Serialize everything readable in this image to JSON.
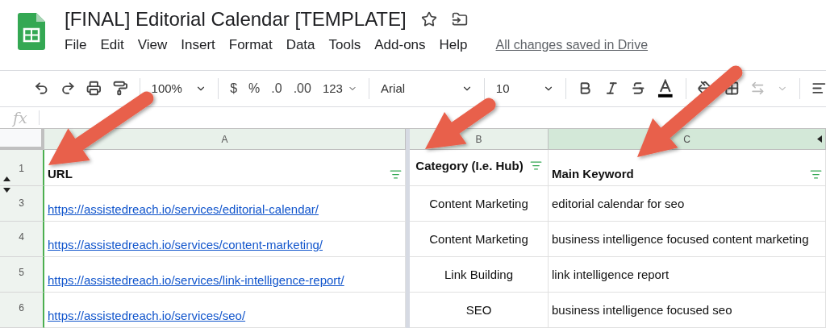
{
  "document": {
    "title": "[FINAL] Editorial Calendar [TEMPLATE]",
    "starred": false,
    "save_status": "All changes saved in Drive"
  },
  "menu": [
    "File",
    "Edit",
    "View",
    "Insert",
    "Format",
    "Data",
    "Tools",
    "Add-ons",
    "Help"
  ],
  "toolbar": {
    "zoom": "100%",
    "currency": "$",
    "percent": "%",
    "decrease_decimals": ".0",
    "increase_decimals": ".00",
    "number_format": "123",
    "font": "Arial",
    "font_size": "10"
  },
  "formula_bar": {
    "label": "fx"
  },
  "columns": [
    {
      "letter": "A",
      "selected": false,
      "header": "URL",
      "filter": true
    },
    {
      "letter": "B",
      "selected": false,
      "header": "Category (I.e. Hub)",
      "filter": true
    },
    {
      "letter": "C",
      "selected": true,
      "header": "Main Keyword",
      "filter": true
    }
  ],
  "rows": [
    {
      "number": "3",
      "cells": [
        {
          "kind": "link",
          "text": "https://assistedreach.io/services/editorial-calendar/"
        },
        {
          "kind": "text",
          "text": "Content Marketing"
        },
        {
          "kind": "text",
          "text": "editorial calendar for seo"
        }
      ]
    },
    {
      "number": "4",
      "cells": [
        {
          "kind": "link",
          "text": "https://assistedreach.io/services/content-marketing/"
        },
        {
          "kind": "text",
          "text": "Content Marketing"
        },
        {
          "kind": "text",
          "text": "business intelligence focused content marketing"
        }
      ]
    },
    {
      "number": "5",
      "cells": [
        {
          "kind": "link",
          "text": "https://assistedreach.io/services/link-intelligence-report/"
        },
        {
          "kind": "text",
          "text": "Link Building"
        },
        {
          "kind": "text",
          "text": "link intelligence report"
        }
      ]
    },
    {
      "number": "6",
      "cells": [
        {
          "kind": "link",
          "text": "https://assistedreach.io/services/seo/"
        },
        {
          "kind": "text",
          "text": "SEO"
        },
        {
          "kind": "text",
          "text": "business intelligence focused seo"
        }
      ]
    }
  ],
  "header_row_number": "1",
  "annotations": [
    {
      "kind": "arrow"
    },
    {
      "kind": "arrow"
    },
    {
      "kind": "arrow"
    }
  ]
}
